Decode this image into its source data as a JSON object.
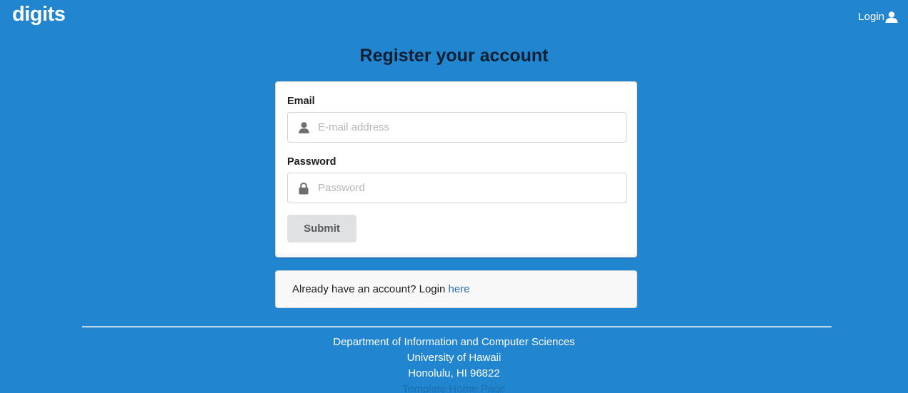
{
  "navbar": {
    "brand": "digits",
    "login_label": "Login"
  },
  "heading": "Register your account",
  "form": {
    "email_label": "Email",
    "email_placeholder": "E-mail address",
    "password_label": "Password",
    "password_placeholder": "Password",
    "submit_label": "Submit"
  },
  "message": {
    "text": "Already have an account? Login ",
    "link_label": "here"
  },
  "footer": {
    "lines": [
      "Department of Information and Computer Sciences",
      "University of Hawaii",
      "Honolulu, HI 96822"
    ],
    "link_label": "Template Home Page"
  },
  "colors": {
    "background": "#2185d0",
    "heading": "#0b1f33",
    "link": "#2e6fb5"
  },
  "icons": {
    "navbar_login": "user-icon",
    "email_field": "user-icon",
    "password_field": "lock-icon"
  }
}
